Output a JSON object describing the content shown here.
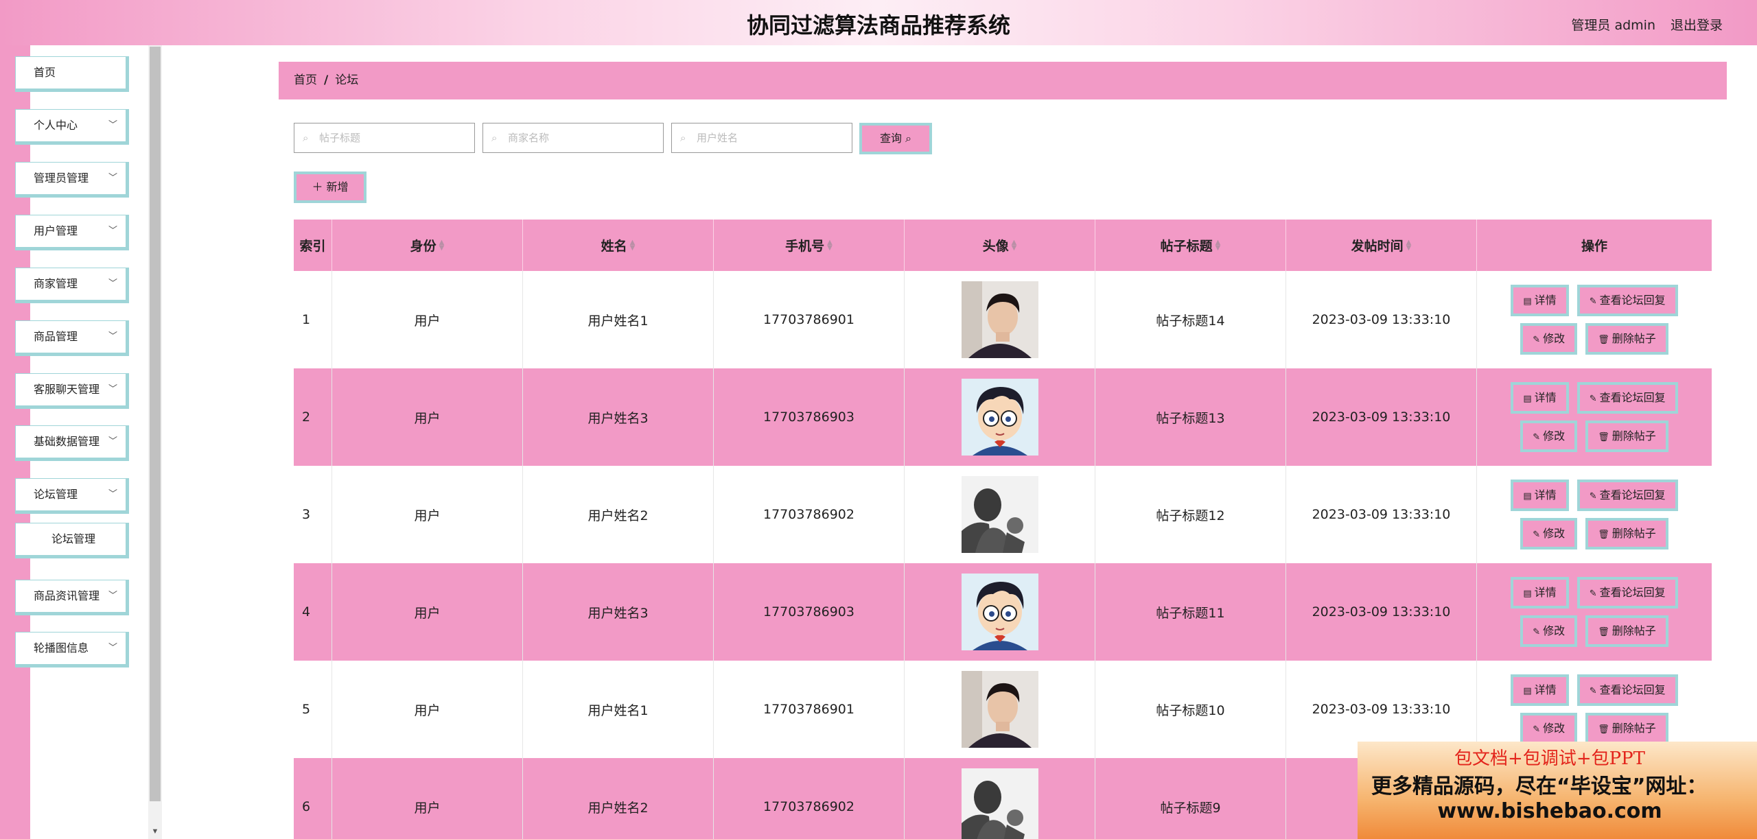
{
  "header": {
    "title": "协同过滤算法商品推荐系统",
    "user": "管理员 admin",
    "logout": "退出登录"
  },
  "sidebar": {
    "items": [
      {
        "label": "首页"
      },
      {
        "label": "个人中心"
      },
      {
        "label": "管理员管理"
      },
      {
        "label": "用户管理"
      },
      {
        "label": "商家管理"
      },
      {
        "label": "商品管理"
      },
      {
        "label": "客服聊天管理"
      },
      {
        "label": "基础数据管理"
      },
      {
        "label": "论坛管理"
      },
      {
        "label": "论坛管理"
      },
      {
        "label": "商品资讯管理"
      },
      {
        "label": "轮播图信息"
      }
    ]
  },
  "breadcrumb": {
    "home": "首页",
    "separator": "/",
    "current": "论坛"
  },
  "search": {
    "post_title_placeholder": "帖子标题",
    "merchant_placeholder": "商家名称",
    "user_placeholder": "用户姓名",
    "query_label": "查询"
  },
  "toolbar": {
    "add_label": "新增"
  },
  "table": {
    "headers": [
      "索引",
      "身份",
      "姓名",
      "手机号",
      "头像",
      "帖子标题",
      "发帖时间",
      "操作"
    ],
    "rows": [
      {
        "index": "1",
        "identity": "用户",
        "name": "用户姓名1",
        "phone": "17703786901",
        "avatar": "photo-man",
        "title": "帖子标题14",
        "time": "2023-03-09 13:33:10"
      },
      {
        "index": "2",
        "identity": "用户",
        "name": "用户姓名3",
        "phone": "17703786903",
        "avatar": "cartoon-boy",
        "title": "帖子标题13",
        "time": "2023-03-09 13:33:10"
      },
      {
        "index": "3",
        "identity": "用户",
        "name": "用户姓名2",
        "phone": "17703786902",
        "avatar": "silhouette",
        "title": "帖子标题12",
        "time": "2023-03-09 13:33:10"
      },
      {
        "index": "4",
        "identity": "用户",
        "name": "用户姓名3",
        "phone": "17703786903",
        "avatar": "cartoon-boy",
        "title": "帖子标题11",
        "time": "2023-03-09 13:33:10"
      },
      {
        "index": "5",
        "identity": "用户",
        "name": "用户姓名1",
        "phone": "17703786901",
        "avatar": "photo-man",
        "title": "帖子标题10",
        "time": "2023-03-09 13:33:10"
      },
      {
        "index": "6",
        "identity": "用户",
        "name": "用户姓名2",
        "phone": "17703786902",
        "avatar": "silhouette",
        "title": "帖子标题9",
        "time": "2023-"
      }
    ],
    "actions": {
      "detail": "详情",
      "view_reply": "查看论坛回复",
      "edit": "修改",
      "delete": "删除帖子"
    }
  },
  "watermark": {
    "line1": "包文档+包调试+包PPT",
    "line2": "更多精品源码，尽在“毕设宝”网址：",
    "line3": "www.bishebao.com"
  },
  "colors": {
    "accent_pink": "#f29ac6",
    "accent_teal": "#9fd5d8"
  }
}
